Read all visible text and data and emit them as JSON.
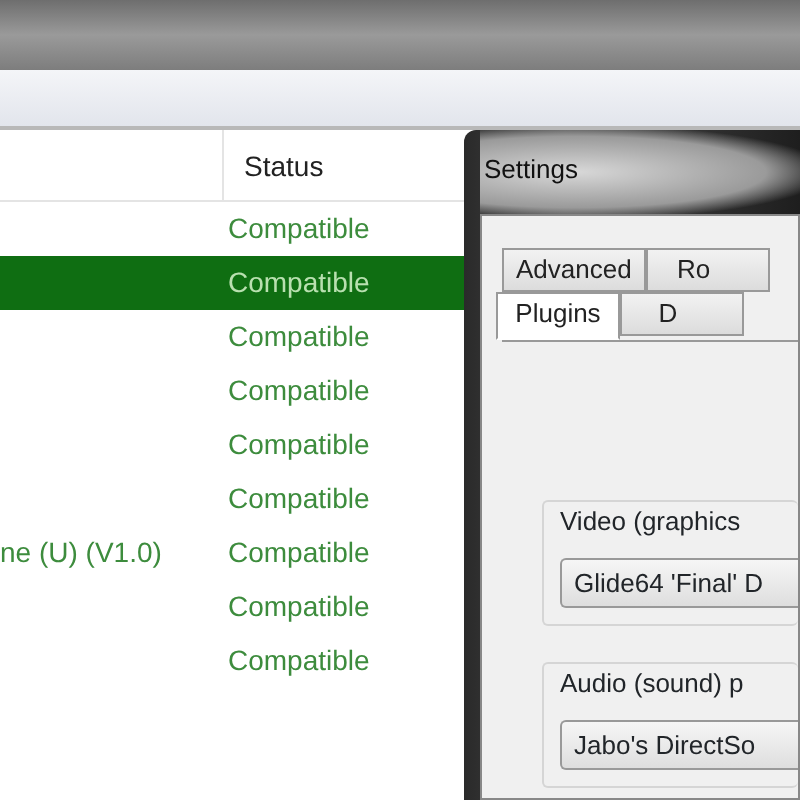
{
  "list": {
    "columns": [
      "Status"
    ],
    "rows": [
      {
        "status": "Compatible",
        "selected": false
      },
      {
        "status": "Compatible",
        "selected": true
      },
      {
        "status": "Compatible",
        "selected": false
      },
      {
        "status": "Compatible",
        "selected": false
      },
      {
        "status": "Compatible",
        "selected": false
      },
      {
        "status": "Compatible",
        "selected": false
      },
      {
        "name": "ne (U) (V1.0)",
        "status": "Compatible",
        "selected": false
      },
      {
        "status": "Compatible",
        "selected": false
      },
      {
        "status": "Compatible",
        "selected": false
      }
    ]
  },
  "dialog": {
    "title": "Settings",
    "tab_rows": [
      [
        {
          "label": "Advanced",
          "selected": false
        },
        {
          "label": "Ro",
          "selected": false
        }
      ],
      [
        {
          "label": "Plugins",
          "selected": true
        },
        {
          "label": "D",
          "selected": false
        }
      ]
    ],
    "groups": [
      {
        "label": "Video (graphics",
        "value": "Glide64 'Final' D"
      },
      {
        "label": "Audio (sound) p",
        "value": "Jabo's DirectSo"
      }
    ]
  }
}
